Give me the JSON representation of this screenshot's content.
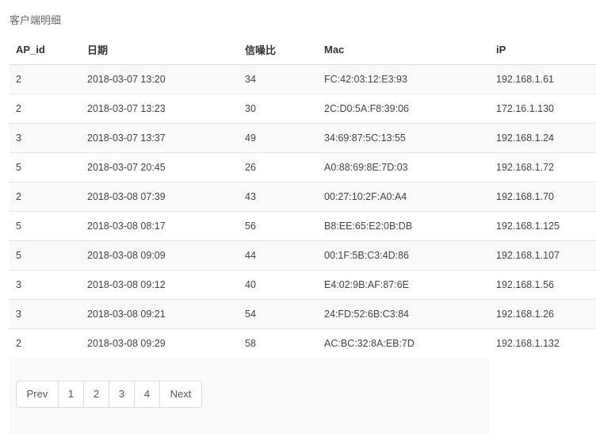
{
  "page": {
    "title": "客户端明细"
  },
  "table": {
    "headers": {
      "ap_id": "AP_id",
      "date": "日期",
      "snr": "信噪比",
      "mac": "Mac",
      "ip": "iP"
    },
    "rows": [
      {
        "ap_id": "2",
        "date": "2018-03-07 13:20",
        "snr": "34",
        "mac": "FC:42:03:12:E3:93",
        "ip": "192.168.1.61"
      },
      {
        "ap_id": "2",
        "date": "2018-03-07 13:23",
        "snr": "30",
        "mac": "2C:D0:5A:F8:39:06",
        "ip": "172.16.1.130"
      },
      {
        "ap_id": "3",
        "date": "2018-03-07 13:37",
        "snr": "49",
        "mac": "34:69:87:5C:13:55",
        "ip": "192.168.1.24"
      },
      {
        "ap_id": "5",
        "date": "2018-03-07 20:45",
        "snr": "26",
        "mac": "A0:88:69:8E:7D:03",
        "ip": "192.168.1.72"
      },
      {
        "ap_id": "2",
        "date": "2018-03-08 07:39",
        "snr": "43",
        "mac": "00:27:10:2F:A0:A4",
        "ip": "192.168.1.70"
      },
      {
        "ap_id": "5",
        "date": "2018-03-08 08:17",
        "snr": "56",
        "mac": "B8:EE:65:E2:0B:DB",
        "ip": "192.168.1.125"
      },
      {
        "ap_id": "5",
        "date": "2018-03-08 09:09",
        "snr": "44",
        "mac": "00:1F:5B:C3:4D:86",
        "ip": "192.168.1.107"
      },
      {
        "ap_id": "3",
        "date": "2018-03-08 09:12",
        "snr": "40",
        "mac": "E4:02:9B:AF:87:6E",
        "ip": "192.168.1.56"
      },
      {
        "ap_id": "3",
        "date": "2018-03-08 09:21",
        "snr": "54",
        "mac": "24:FD:52:6B:C3:84",
        "ip": "192.168.1.26"
      },
      {
        "ap_id": "2",
        "date": "2018-03-08 09:29",
        "snr": "58",
        "mac": "AC:BC:32:8A:EB:7D",
        "ip": "192.168.1.132"
      }
    ]
  },
  "pagination": {
    "prev": "Prev",
    "pages": [
      "1",
      "2",
      "3",
      "4"
    ],
    "next": "Next"
  },
  "colors": {
    "stripe": "#f9f9f9",
    "border": "#dddddd",
    "text": "#333333"
  }
}
